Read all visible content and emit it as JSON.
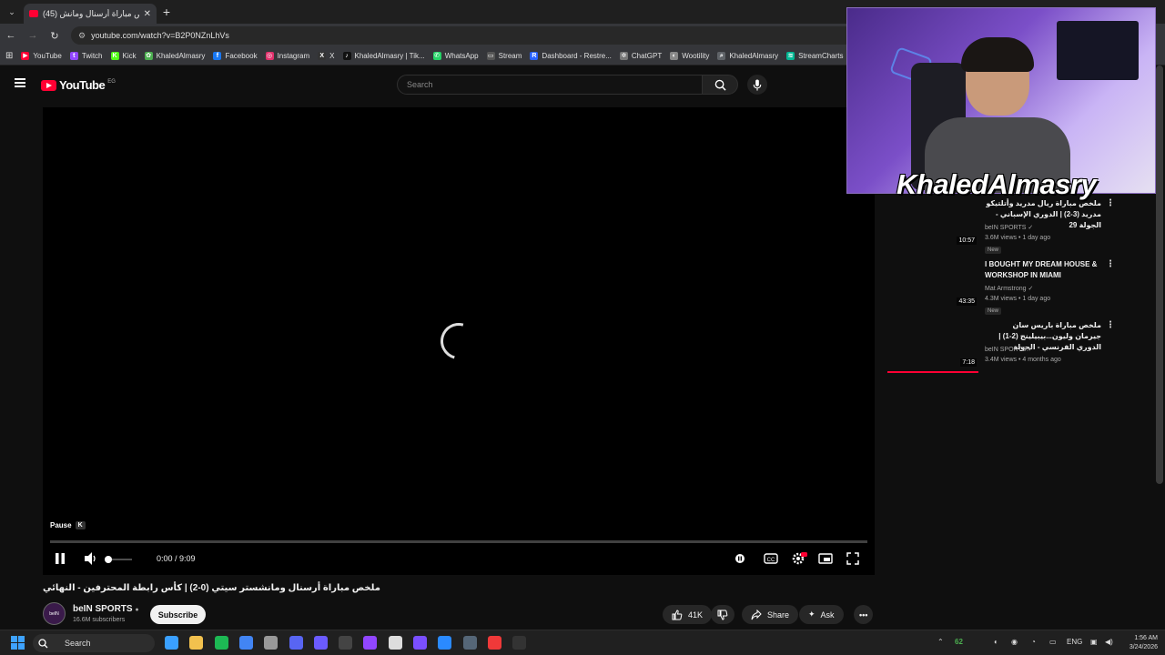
{
  "browser": {
    "tab_title": "(45) ملخص مباراة أرسنال ومانش...",
    "url": "youtube.com/watch?v=B2P0NZnLhVs",
    "bookmarks": [
      {
        "label": "YouTube",
        "color": "#ff0033",
        "glyph": "▶"
      },
      {
        "label": "Twitch",
        "color": "#9146ff",
        "glyph": "t"
      },
      {
        "label": "Kick",
        "color": "#53fc18",
        "glyph": "K"
      },
      {
        "label": "KhaledAlmasry",
        "color": "#4caf50",
        "glyph": "✿"
      },
      {
        "label": "Facebook",
        "color": "#1877f2",
        "glyph": "f"
      },
      {
        "label": "Instagram",
        "color": "#e1306c",
        "glyph": "◎"
      },
      {
        "label": "X",
        "color": "#333333",
        "glyph": "X"
      },
      {
        "label": "KhaledAlmasry | Tik...",
        "color": "#111111",
        "glyph": "♪"
      },
      {
        "label": "WhatsApp",
        "color": "#25d366",
        "glyph": "✆"
      },
      {
        "label": "Stream",
        "color": "#555555",
        "glyph": "▭"
      },
      {
        "label": "Dashboard - Restre...",
        "color": "#2962ff",
        "glyph": "R"
      },
      {
        "label": "ChatGPT",
        "color": "#777777",
        "glyph": "✲"
      },
      {
        "label": "Wootility",
        "color": "#888888",
        "glyph": "◐"
      },
      {
        "label": "KhaledAlmasry",
        "color": "#5f6368",
        "glyph": "⌕"
      },
      {
        "label": "StreamCharts",
        "color": "#00b894",
        "glyph": "≋"
      }
    ]
  },
  "youtube": {
    "logo_text": "YouTube",
    "country_code": "EG",
    "search_placeholder": "Search"
  },
  "player": {
    "tooltip_label": "Pause",
    "tooltip_key": "K",
    "time": "0:00 / 9:09",
    "progress": 0,
    "volume": 0.3
  },
  "video": {
    "title": "ملخص مباراة أرسنال ومانشستر سيتي (0-2) | كأس رابطة المحترفين - النهائي",
    "channel": "beIN SPORTS",
    "subscribers": "16.6M subscribers",
    "subscribe_label": "Subscribe",
    "likes": "41K",
    "share_label": "Share",
    "ask_label": "Ask",
    "avatar_text": "beIN"
  },
  "webcam": {
    "overlay_name": "KhaledAlmasry"
  },
  "recommendations": [
    {
      "title": "ملخص مباراة ريال مدريد وأتلتيكو مدريد (3-2) | الدوري الإسباني - الجولة 29",
      "channel": "beIN SPORTS",
      "meta": "3.6M views • 1 day ago",
      "badge": "New",
      "duration": "10:57",
      "rtl": true
    },
    {
      "title": "I BOUGHT MY DREAM HOUSE & WORKSHOP IN MIAMI",
      "channel": "Mat Armstrong",
      "meta": "4.3M views • 1 day ago",
      "badge": "New",
      "duration": "43:35",
      "rtl": false
    },
    {
      "title": "ملخص مباراة باريس سان جيرمان وليون...بيبيلينج (2-1) | الدوري الفرنسي - الجولة",
      "channel": "beIN SPORTS",
      "meta": "3.4M views • 4 months ago",
      "badge": "",
      "duration": "7:18",
      "rtl": true,
      "watched": 1
    }
  ],
  "taskbar": {
    "search_label": "Search",
    "temp": "62",
    "lang": "ENG",
    "time": "1:56 AM",
    "date": "3/24/2026"
  },
  "colors": {
    "accent": "#ff0033",
    "bg": "#0f0f0f"
  }
}
